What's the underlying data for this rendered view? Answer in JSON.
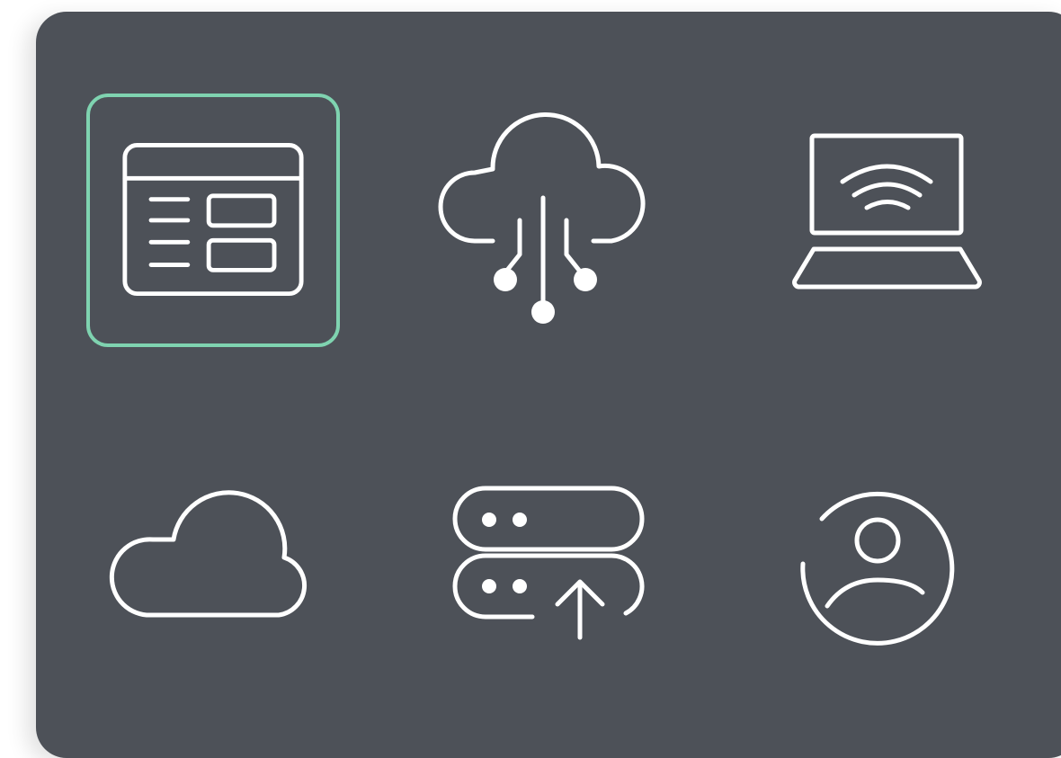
{
  "colors": {
    "panel_background": "#4d5158",
    "icon_stroke": "#ffffff",
    "selection_outline": "#7fd3b0",
    "page_background": "#ffffff"
  },
  "icons": [
    {
      "name": "web-dashboard-icon",
      "selected": true
    },
    {
      "name": "cloud-network-icon",
      "selected": false
    },
    {
      "name": "laptop-wifi-icon",
      "selected": false
    },
    {
      "name": "cloud-icon",
      "selected": false
    },
    {
      "name": "server-upload-icon",
      "selected": false
    },
    {
      "name": "user-account-icon",
      "selected": false
    }
  ]
}
